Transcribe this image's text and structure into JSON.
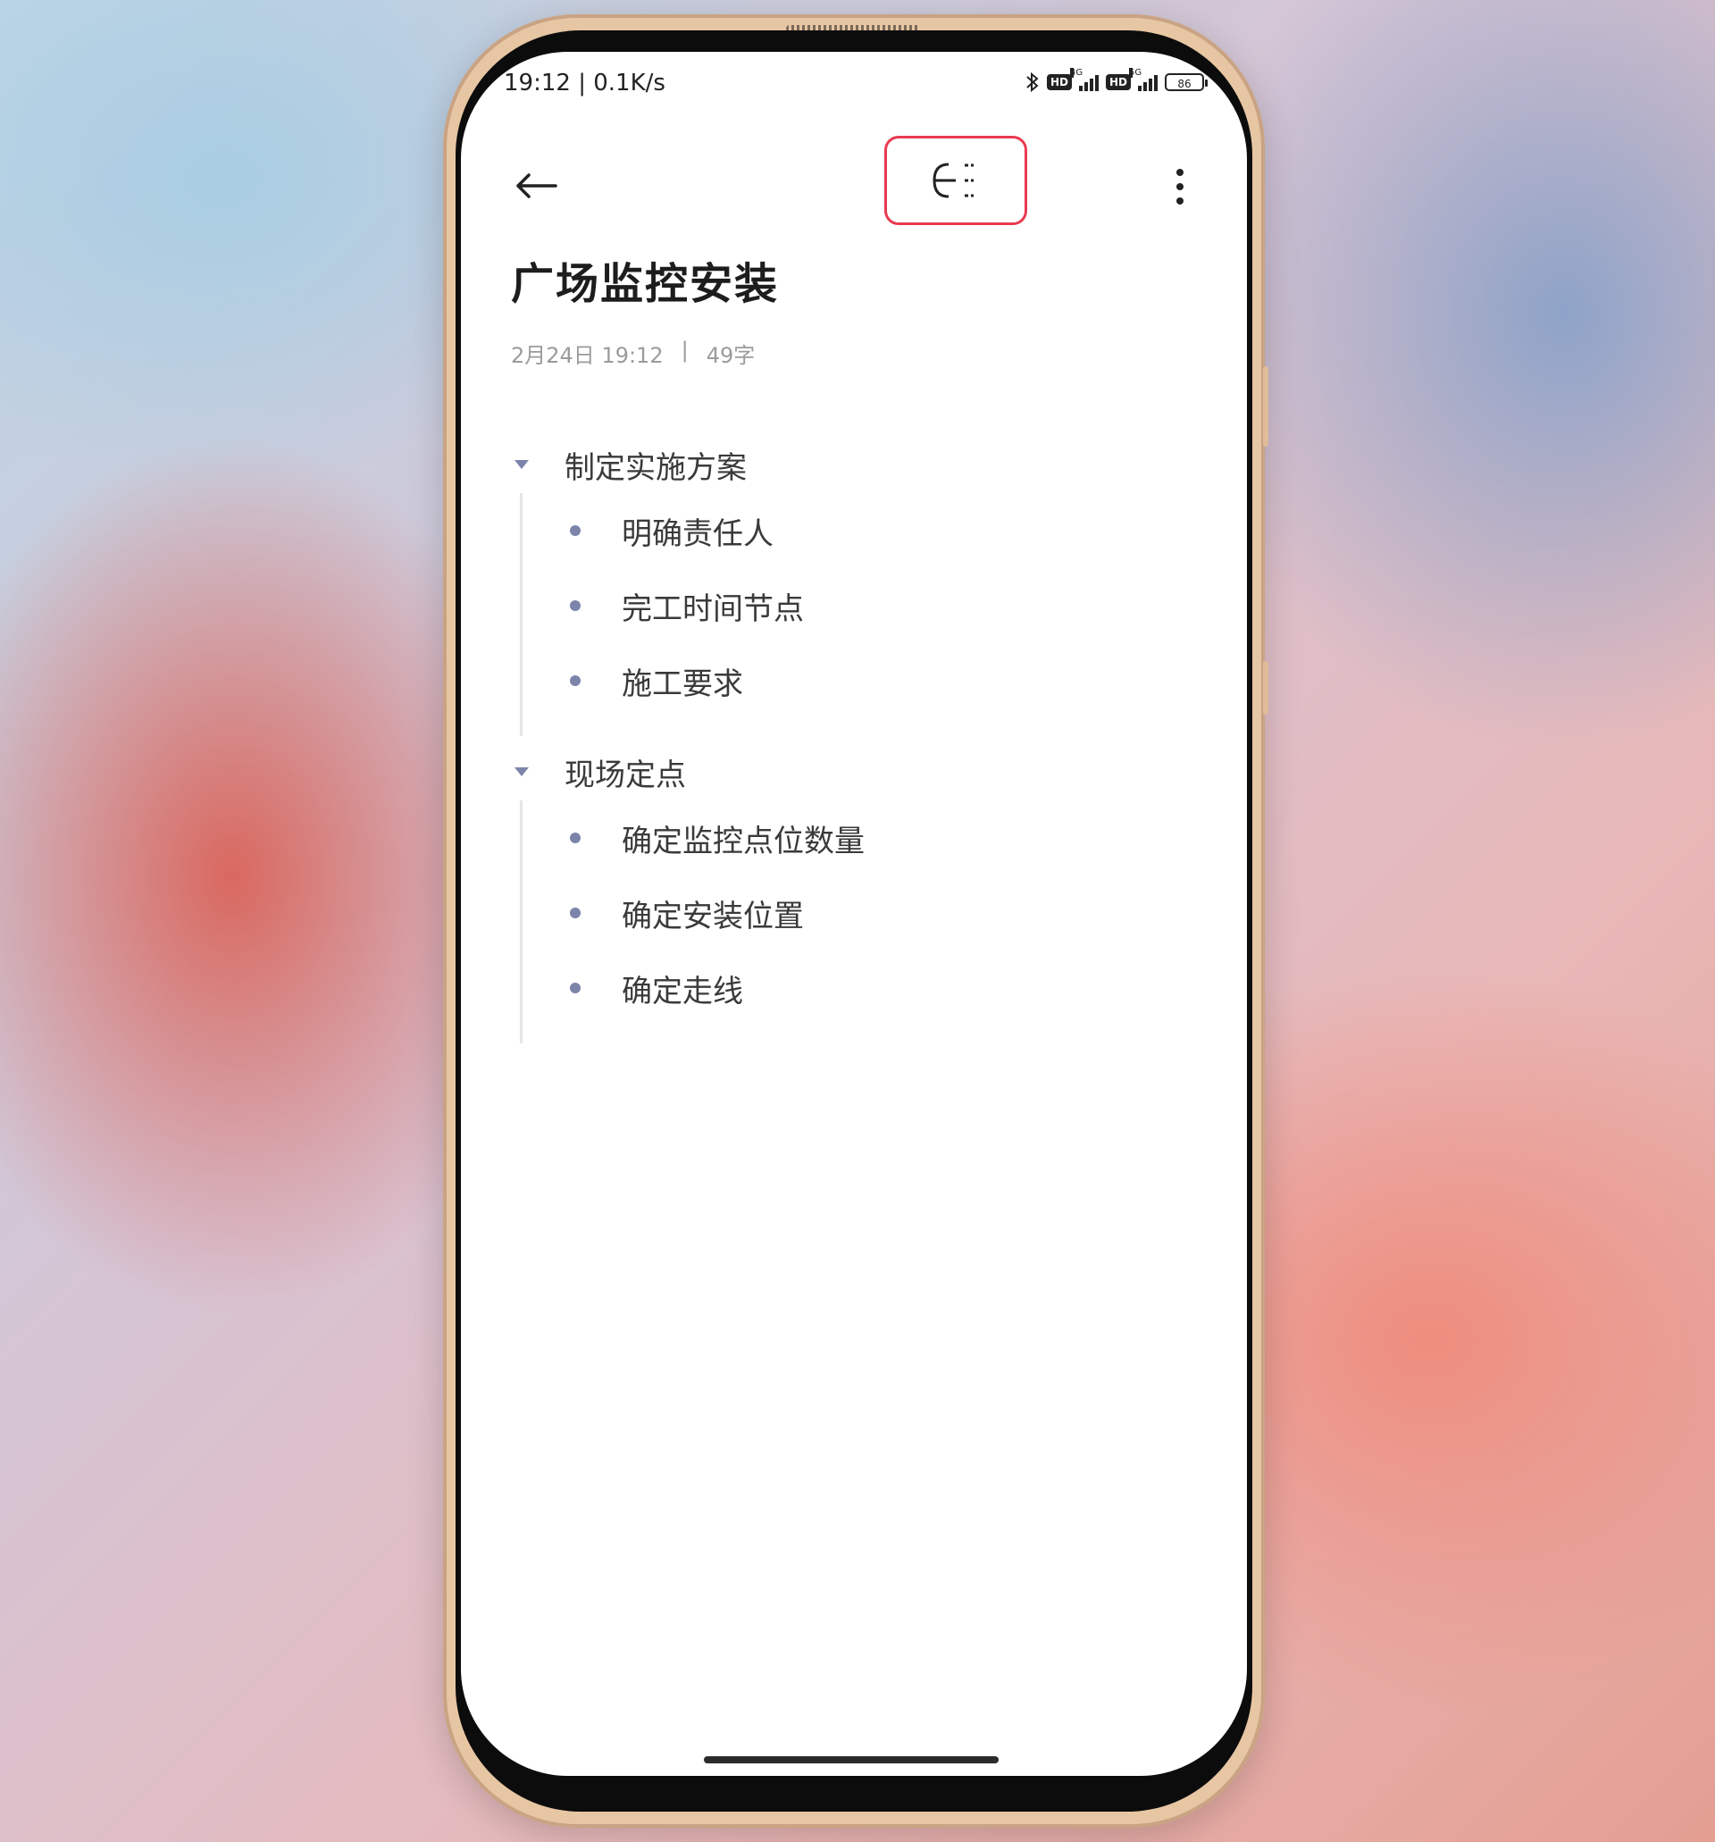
{
  "status_bar": {
    "time_speed": "19:12 | 0.1K/s",
    "badge_1": "HD",
    "net_1": "4G",
    "badge_2": "HD",
    "net_2": "5G",
    "battery": "86"
  },
  "note": {
    "title": "广场监控安装",
    "date": "2月24日 19:12",
    "separator": "|",
    "word_count": "49字"
  },
  "outline": [
    {
      "label": "制定实施方案",
      "children": [
        "明确责任人",
        "完工时间节点",
        "施工要求"
      ]
    },
    {
      "label": "现场定点",
      "children": [
        "确定监控点位数量",
        "确定安装位置",
        "确定走线"
      ]
    }
  ],
  "icons": {
    "back": "back-arrow-icon",
    "outline_view": "outline-view-icon",
    "more": "more-vertical-icon",
    "bluetooth": "bluetooth-icon"
  },
  "colors": {
    "highlight_border": "#e83a4f",
    "bullet": "#7c84aa",
    "phone_frame": "#e7c6a3"
  }
}
